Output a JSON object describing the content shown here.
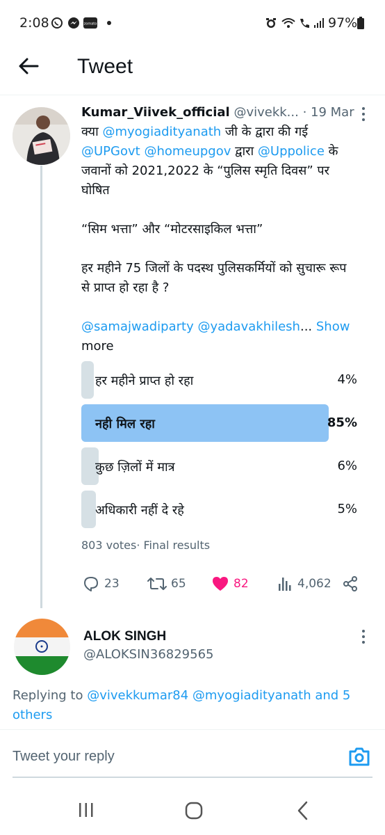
{
  "status_bar": {
    "time": "2:08",
    "battery": "97%",
    "icons": [
      "whatsapp-icon",
      "messenger-icon",
      "zomato-icon",
      "dot-icon",
      "alarm-icon",
      "wifi-call-icon",
      "call-icon",
      "signal-icon",
      "battery-icon"
    ],
    "zomato_label": "zomato"
  },
  "header": {
    "title": "Tweet"
  },
  "tweet": {
    "author_name": "Kumar_Viivek_official",
    "author_handle": "@vivekk...",
    "date": "· 19 Mar",
    "lines": {
      "l1_prefix": "क्या ",
      "l1_mention": "@myogiadityanath",
      "l1_suffix": " जी के द्वारा की गई",
      "l2_mention1": "@UPGovt",
      "l2_mention2": "@homeupgov",
      "l2_mid": " द्वारा ",
      "l2_mention3": "@Uppolice",
      "l2_suffix": " के",
      "l3": "जवानों को 2021,2022 के “पुलिस स्मृति दिवस” पर",
      "l4": "घोषित",
      "l5": "“सिम भत्ता” और “मोटरसाइकिल भत्ता”",
      "l6": "हर महीने 75 जिलों के पदस्थ पुलिसकर्मियों को सुचारू रूप",
      "l7": "से प्राप्त हो रहा है ?",
      "l8_mention1": "@samajwadiparty",
      "l8_mention2": "@yadavakhilesh",
      "l8_ellipsis": "...",
      "show_more_1": "Show",
      "show_more_2": "more"
    },
    "poll": {
      "options": [
        {
          "label": "हर महीने प्राप्त हो रहा",
          "percent": "4%",
          "fraction": 0.04,
          "winner": false
        },
        {
          "label": "नही मिल रहा",
          "percent": "85%",
          "fraction": 0.85,
          "winner": true
        },
        {
          "label": "कुछ ज़िलों में मात्र",
          "percent": "6%",
          "fraction": 0.06,
          "winner": false
        },
        {
          "label": "अधिकारी नहीं दे रहे",
          "percent": "5%",
          "fraction": 0.05,
          "winner": false
        }
      ],
      "votes": "803 votes",
      "status": "· Final results"
    },
    "actions": {
      "replies": "23",
      "retweets": "65",
      "likes": "82",
      "views": "4,062"
    },
    "colors": {
      "accent": "#1d9bf0",
      "like": "#f91880",
      "poll_winner": "#8dc3f4",
      "poll_other": "#d6e0e5"
    }
  },
  "reply_author": {
    "name": "ALOK SINGH",
    "handle": "@ALOKSIN36829565"
  },
  "replying_to": {
    "prefix": "Replying to ",
    "mention1": "@vivekkumar84",
    "mention2": "@myogiadityanath",
    "and_text": " and 5",
    "others": "others"
  },
  "reply_box": {
    "placeholder": "Tweet your reply"
  }
}
